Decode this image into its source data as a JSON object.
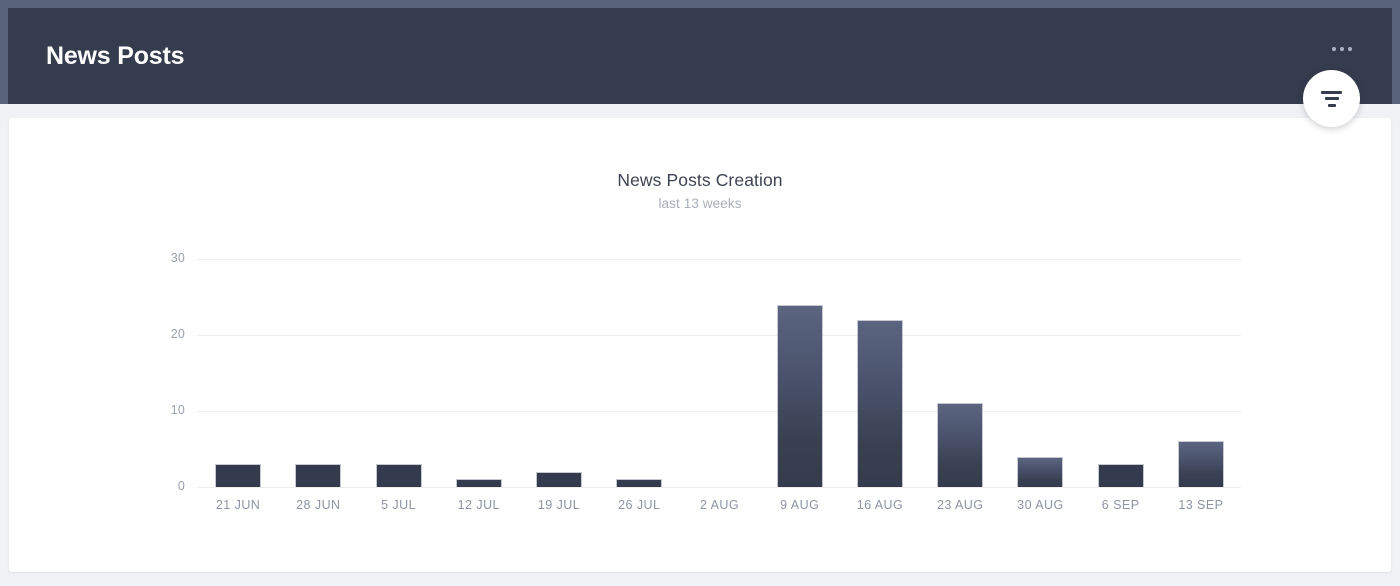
{
  "app": {
    "title": "News Posts",
    "accent_frame_color": "#59647c",
    "appbar_color": "#343c4e",
    "page_background": "#f1f2f5"
  },
  "appbar": {
    "title": "News Posts",
    "overflow_menu_label": "...",
    "overflow_menu_icon": "kebab-horizontal-icon"
  },
  "fab": {
    "icon": "filter-icon",
    "label": "Filter"
  },
  "chart_data": {
    "type": "bar",
    "title": "News Posts Creation",
    "subtitle": "last 13 weeks",
    "xlabel": "",
    "ylabel": "",
    "ylim": [
      0,
      30
    ],
    "yticks": [
      0,
      10,
      20,
      30
    ],
    "grid": true,
    "legend": false,
    "bar_color_top": "#5b6580",
    "bar_color_bottom": "#343b4c",
    "categories": [
      "21 JUN",
      "28 JUN",
      "5 JUL",
      "12 JUL",
      "19 JUL",
      "26 JUL",
      "2 AUG",
      "9 AUG",
      "16 AUG",
      "23 AUG",
      "30 AUG",
      "6 SEP",
      "13 SEP"
    ],
    "values": [
      3,
      3,
      3,
      1,
      2,
      1,
      0,
      24,
      22,
      11,
      4,
      3,
      6
    ]
  }
}
